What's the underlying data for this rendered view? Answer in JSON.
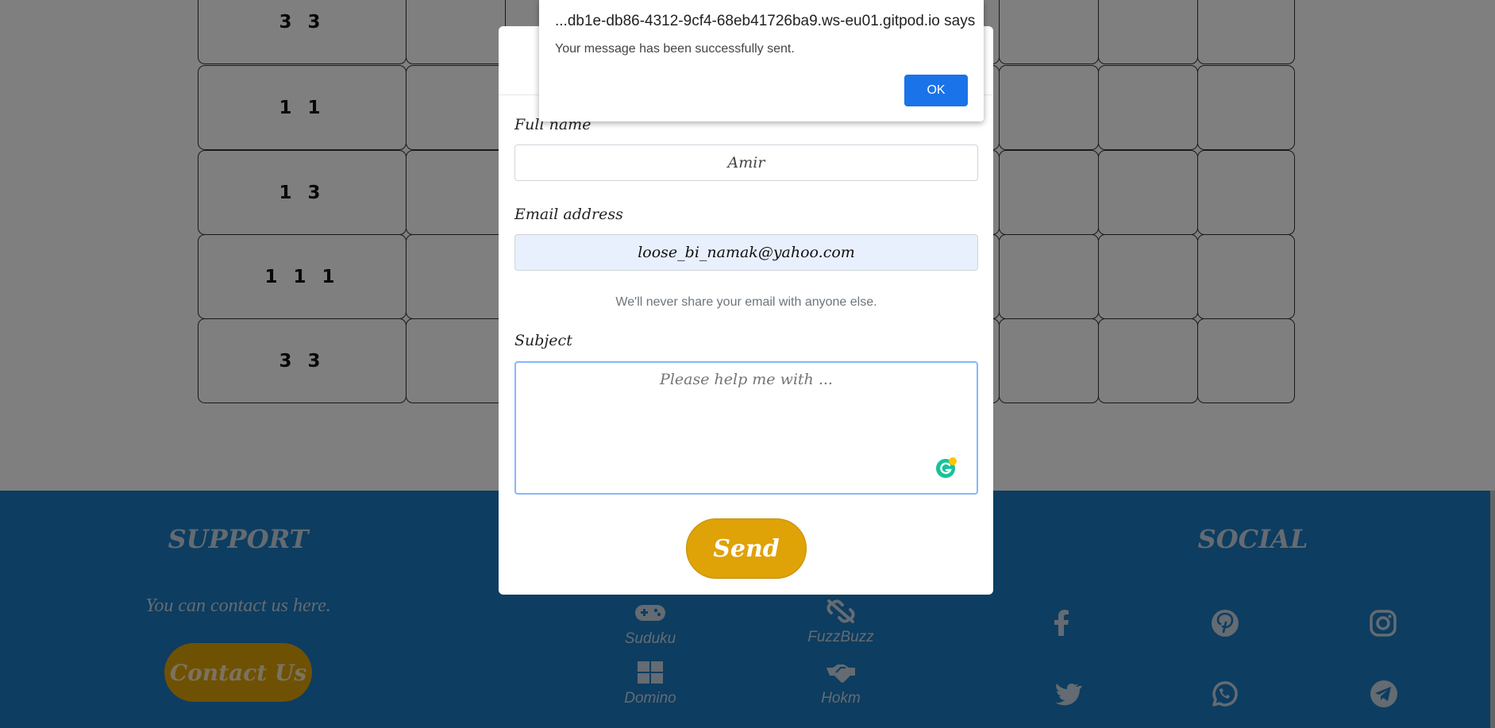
{
  "puzzle": {
    "row_clues": [
      "3 3",
      "1 1",
      "1 3",
      "1 1 1",
      "3 3"
    ]
  },
  "footer": {
    "support": {
      "title": "SUPPORT",
      "text": "You can contact us here.",
      "button": "Contact Us"
    },
    "games": [
      {
        "label": "Suduku",
        "icon": "gamepad-icon"
      },
      {
        "label": "FuzzBuzz",
        "icon": "broken-link-icon"
      },
      {
        "label": "Domino",
        "icon": "grid-icon"
      },
      {
        "label": "Hokm",
        "icon": "handshake-icon"
      }
    ],
    "social": {
      "title": "SOCIAL",
      "icons": [
        "facebook-icon",
        "pinterest-icon",
        "instagram-icon",
        "twitter-icon",
        "whatsapp-icon",
        "telegram-icon"
      ]
    }
  },
  "modal": {
    "fullname_label": "Full name",
    "fullname_value": "Amir",
    "email_label": "Email address",
    "email_value": "loose_bi_namak@yahoo.com",
    "email_hint": "We'll never share your email with anyone else.",
    "subject_label": "Subject",
    "subject_placeholder": "Please help me with ...",
    "send_label": "Send"
  },
  "alert": {
    "title": "...db1e-db86-4312-9cf4-68eb41726ba9.ws-eu01.gitpod.io says",
    "message": "Your message has been successfully sent.",
    "ok_label": "OK"
  },
  "colors": {
    "footer_bg": "#1a7bc1",
    "button_gold": "#dfa207",
    "ok_blue": "#1a73e8",
    "autofill_bg": "#e8f0fe"
  }
}
